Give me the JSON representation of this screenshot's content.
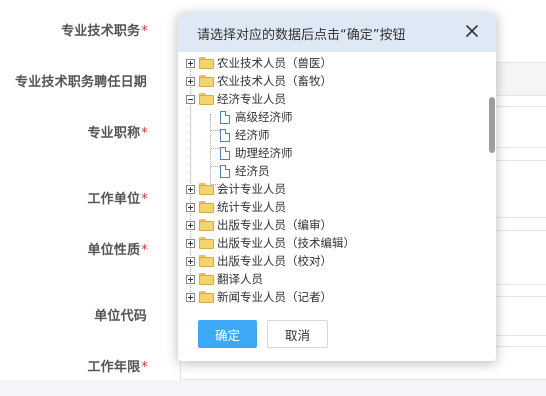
{
  "form": {
    "labels": [
      {
        "text": "专业技术职务",
        "required": "*"
      },
      {
        "text": "专业技术职务聘任日期",
        "required": ""
      },
      {
        "text": "专业职称",
        "required": "*"
      },
      {
        "text": "工作单位",
        "required": "*"
      },
      {
        "text": "单位性质",
        "required": "*"
      },
      {
        "text": "单位代码",
        "required": ""
      },
      {
        "text": "工作年限",
        "required": "*"
      }
    ]
  },
  "dialog": {
    "title": "请选择对应的数据后点击“确定”按钮",
    "close_icon": "close-icon",
    "tree": [
      {
        "label": "农业技术人员（兽医）",
        "type": "folder",
        "state": "collapsed"
      },
      {
        "label": "农业技术人员（畜牧）",
        "type": "folder",
        "state": "collapsed"
      },
      {
        "label": "经济专业人员",
        "type": "folder",
        "state": "expanded",
        "children": [
          {
            "label": "高级经济师",
            "type": "leaf"
          },
          {
            "label": "经济师",
            "type": "leaf"
          },
          {
            "label": "助理经济师",
            "type": "leaf"
          },
          {
            "label": "经济员",
            "type": "leaf"
          }
        ]
      },
      {
        "label": "会计专业人员",
        "type": "folder",
        "state": "collapsed"
      },
      {
        "label": "统计专业人员",
        "type": "folder",
        "state": "collapsed"
      },
      {
        "label": "出版专业人员（编审）",
        "type": "folder",
        "state": "collapsed"
      },
      {
        "label": "出版专业人员（技术编辑）",
        "type": "folder",
        "state": "collapsed"
      },
      {
        "label": "出版专业人员（校对）",
        "type": "folder",
        "state": "collapsed"
      },
      {
        "label": "翻译人员",
        "type": "folder",
        "state": "collapsed"
      },
      {
        "label": "新闻专业人员（记者）",
        "type": "folder",
        "state": "collapsed"
      }
    ],
    "buttons": {
      "ok": "确定",
      "cancel": "取消"
    }
  },
  "colors": {
    "primary_button": "#3da8f5",
    "header_bg": "#dfe9f5",
    "required_mark": "#e0312f"
  }
}
